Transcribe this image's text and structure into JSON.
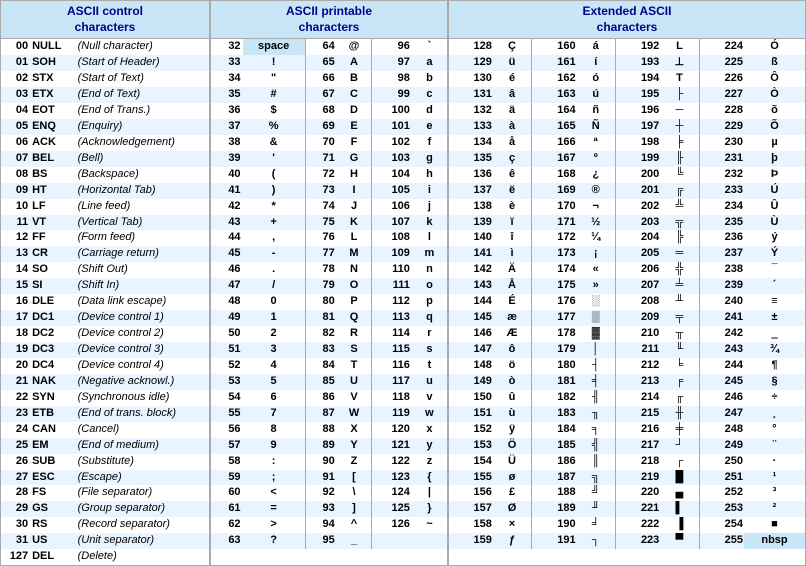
{
  "sections": {
    "control": {
      "header": "ASCII control\ncharacters"
    },
    "printable": {
      "header": "ASCII printable\ncharacters"
    },
    "extended": {
      "header": "Extended ASCII\ncharacters"
    }
  },
  "control_rows": [
    [
      "00",
      "NULL",
      "(Null character)"
    ],
    [
      "01",
      "SOH",
      "(Start of Header)"
    ],
    [
      "02",
      "STX",
      "(Start of Text)"
    ],
    [
      "03",
      "ETX",
      "(End of Text)"
    ],
    [
      "04",
      "EOT",
      "(End of Trans.)"
    ],
    [
      "05",
      "ENQ",
      "(Enquiry)"
    ],
    [
      "06",
      "ACK",
      "(Acknowledgement)"
    ],
    [
      "07",
      "BEL",
      "(Bell)"
    ],
    [
      "08",
      "BS",
      "(Backspace)"
    ],
    [
      "09",
      "HT",
      "(Horizontal Tab)"
    ],
    [
      "10",
      "LF",
      "(Line feed)"
    ],
    [
      "11",
      "VT",
      "(Vertical Tab)"
    ],
    [
      "12",
      "FF",
      "(Form feed)"
    ],
    [
      "13",
      "CR",
      "(Carriage return)"
    ],
    [
      "14",
      "SO",
      "(Shift Out)"
    ],
    [
      "15",
      "SI",
      "(Shift In)"
    ],
    [
      "16",
      "DLE",
      "(Data link escape)"
    ],
    [
      "17",
      "DC1",
      "(Device control 1)"
    ],
    [
      "18",
      "DC2",
      "(Device control 2)"
    ],
    [
      "19",
      "DC3",
      "(Device control 3)"
    ],
    [
      "20",
      "DC4",
      "(Device control 4)"
    ],
    [
      "21",
      "NAK",
      "(Negative acknowl.)"
    ],
    [
      "22",
      "SYN",
      "(Synchronous idle)"
    ],
    [
      "23",
      "ETB",
      "(End of trans. block)"
    ],
    [
      "24",
      "CAN",
      "(Cancel)"
    ],
    [
      "25",
      "EM",
      "(End of medium)"
    ],
    [
      "26",
      "SUB",
      "(Substitute)"
    ],
    [
      "27",
      "ESC",
      "(Escape)"
    ],
    [
      "28",
      "FS",
      "(File separator)"
    ],
    [
      "29",
      "GS",
      "(Group separator)"
    ],
    [
      "30",
      "RS",
      "(Record separator)"
    ],
    [
      "31",
      "US",
      "(Unit separator)"
    ],
    [
      "127",
      "DEL",
      "(Delete)"
    ]
  ],
  "printable_rows": [
    [
      "32",
      "space",
      "64",
      "@",
      "96",
      "`"
    ],
    [
      "33",
      "!",
      "65",
      "A",
      "97",
      "a"
    ],
    [
      "34",
      "\"",
      "66",
      "B",
      "98",
      "b"
    ],
    [
      "35",
      "#",
      "67",
      "C",
      "99",
      "c"
    ],
    [
      "36",
      "$",
      "68",
      "D",
      "100",
      "d"
    ],
    [
      "37",
      "%",
      "69",
      "E",
      "101",
      "e"
    ],
    [
      "38",
      "&",
      "70",
      "F",
      "102",
      "f"
    ],
    [
      "39",
      "'",
      "71",
      "G",
      "103",
      "g"
    ],
    [
      "40",
      "(",
      "72",
      "H",
      "104",
      "h"
    ],
    [
      "41",
      ")",
      "73",
      "I",
      "105",
      "i"
    ],
    [
      "42",
      "*",
      "74",
      "J",
      "106",
      "j"
    ],
    [
      "43",
      "+",
      "75",
      "K",
      "107",
      "k"
    ],
    [
      "44",
      ",",
      "76",
      "L",
      "108",
      "l"
    ],
    [
      "45",
      "-",
      "77",
      "M",
      "109",
      "m"
    ],
    [
      "46",
      ".",
      "78",
      "N",
      "110",
      "n"
    ],
    [
      "47",
      "/",
      "79",
      "O",
      "111",
      "o"
    ],
    [
      "48",
      "0",
      "80",
      "P",
      "112",
      "p"
    ],
    [
      "49",
      "1",
      "81",
      "Q",
      "113",
      "q"
    ],
    [
      "50",
      "2",
      "82",
      "R",
      "114",
      "r"
    ],
    [
      "51",
      "3",
      "83",
      "S",
      "115",
      "s"
    ],
    [
      "52",
      "4",
      "84",
      "T",
      "116",
      "t"
    ],
    [
      "53",
      "5",
      "85",
      "U",
      "117",
      "u"
    ],
    [
      "54",
      "6",
      "86",
      "V",
      "118",
      "v"
    ],
    [
      "55",
      "7",
      "87",
      "W",
      "119",
      "w"
    ],
    [
      "56",
      "8",
      "88",
      "X",
      "120",
      "x"
    ],
    [
      "57",
      "9",
      "89",
      "Y",
      "121",
      "y"
    ],
    [
      "58",
      ":",
      "90",
      "Z",
      "122",
      "z"
    ],
    [
      "59",
      ";",
      "91",
      "[",
      "123",
      "{"
    ],
    [
      "60",
      "<",
      "92",
      "\\",
      "124",
      "|"
    ],
    [
      "61",
      "=",
      "93",
      "]",
      "125",
      "}"
    ],
    [
      "62",
      ">",
      "94",
      "^",
      "126",
      "~"
    ],
    [
      "63",
      "?",
      "95",
      "_",
      "",
      ""
    ]
  ],
  "extended_rows": [
    [
      "128",
      "Ç",
      "160",
      "á",
      "192",
      "L",
      "224",
      "Ó"
    ],
    [
      "129",
      "ü",
      "161",
      "í",
      "193",
      "⊥",
      "225",
      "ß"
    ],
    [
      "130",
      "é",
      "162",
      "ó",
      "194",
      "T",
      "226",
      "Ô"
    ],
    [
      "131",
      "â",
      "163",
      "ú",
      "195",
      "├",
      "227",
      "Ò"
    ],
    [
      "132",
      "ä",
      "164",
      "ñ",
      "196",
      "─",
      "228",
      "õ"
    ],
    [
      "133",
      "à",
      "165",
      "Ñ",
      "197",
      "┼",
      "229",
      "Õ"
    ],
    [
      "134",
      "å",
      "166",
      "ª",
      "198",
      "╞",
      "230",
      "µ"
    ],
    [
      "135",
      "ç",
      "167",
      "º",
      "199",
      "╟",
      "231",
      "þ"
    ],
    [
      "136",
      "ê",
      "168",
      "¿",
      "200",
      "╚",
      "232",
      "Þ"
    ],
    [
      "137",
      "ë",
      "169",
      "®",
      "201",
      "╔",
      "233",
      "Ú"
    ],
    [
      "138",
      "è",
      "170",
      "¬",
      "202",
      "╩",
      "234",
      "Û"
    ],
    [
      "139",
      "ï",
      "171",
      "½",
      "203",
      "╦",
      "235",
      "Ù"
    ],
    [
      "140",
      "î",
      "172",
      "¼",
      "204",
      "╠",
      "236",
      "ý"
    ],
    [
      "141",
      "ì",
      "173",
      "¡",
      "205",
      "═",
      "237",
      "Ý"
    ],
    [
      "142",
      "Ä",
      "174",
      "«",
      "206",
      "╬",
      "238",
      "¯"
    ],
    [
      "143",
      "Å",
      "175",
      "»",
      "207",
      "╧",
      "239",
      "´"
    ],
    [
      "144",
      "É",
      "176",
      "░",
      "208",
      "╨",
      "240",
      "≡"
    ],
    [
      "145",
      "æ",
      "177",
      "▒",
      "209",
      "╤",
      "241",
      "±"
    ],
    [
      "146",
      "Æ",
      "178",
      "▓",
      "210",
      "╥",
      "242",
      "‗"
    ],
    [
      "147",
      "ô",
      "179",
      "│",
      "211",
      "╙",
      "243",
      "¾"
    ],
    [
      "148",
      "ö",
      "180",
      "┤",
      "212",
      "╘",
      "244",
      "¶"
    ],
    [
      "149",
      "ò",
      "181",
      "╡",
      "213",
      "╒",
      "245",
      "§"
    ],
    [
      "150",
      "û",
      "182",
      "╢",
      "214",
      "╓",
      "246",
      "÷"
    ],
    [
      "151",
      "ù",
      "183",
      "╖",
      "215",
      "╫",
      "247",
      "¸"
    ],
    [
      "152",
      "ÿ",
      "184",
      "╕",
      "216",
      "╪",
      "248",
      "°"
    ],
    [
      "153",
      "Ö",
      "185",
      "╣",
      "217",
      "┘",
      "249",
      "¨"
    ],
    [
      "154",
      "Ü",
      "186",
      "║",
      "218",
      "┌",
      "250",
      "·"
    ],
    [
      "155",
      "ø",
      "187",
      "╗",
      "219",
      "█",
      "251",
      "¹"
    ],
    [
      "156",
      "£",
      "188",
      "╝",
      "220",
      "▄",
      "252",
      "³"
    ],
    [
      "157",
      "Ø",
      "189",
      "╜",
      "221",
      "▌",
      "253",
      "²"
    ],
    [
      "158",
      "×",
      "190",
      "╛",
      "222",
      "▐",
      "254",
      "■"
    ],
    [
      "159",
      "ƒ",
      "191",
      "┐",
      "223",
      "▀",
      "255",
      "nbsp"
    ]
  ]
}
